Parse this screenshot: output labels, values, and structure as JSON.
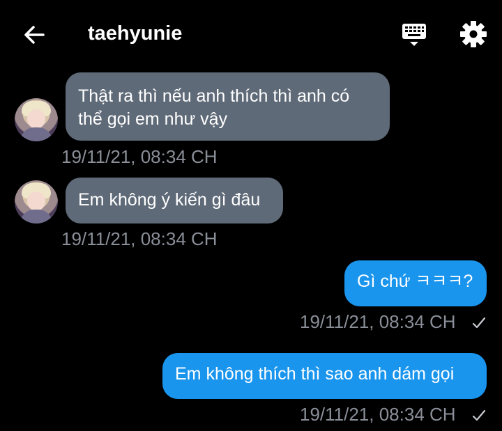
{
  "header": {
    "title": "taehyunie",
    "back_icon": "arrow-left-icon",
    "keyboard_icon": "keyboard-icon",
    "settings_icon": "gear-icon"
  },
  "colors": {
    "background": "#000000",
    "incoming_bubble": "#5f6a78",
    "outgoing_bubble": "#1a95ee",
    "timestamp": "#8a8f98"
  },
  "messages": [
    {
      "direction": "incoming",
      "text_lines": [
        "Thật ra thì nếu anh thích thì anh có",
        "thể gọi em như vậy"
      ],
      "time": "19/11/21, 08:34 CH"
    },
    {
      "direction": "incoming",
      "text": "Em không ý kiến gì đâu",
      "time": "19/11/21, 08:34 CH"
    },
    {
      "direction": "outgoing",
      "text": "Gì chứ ㅋㅋㅋ?",
      "time": "19/11/21, 08:34 CH",
      "status_icon": "check-icon"
    },
    {
      "direction": "outgoing",
      "text": "Em không thích thì sao anh dám gọi",
      "time": "19/11/21, 08:34 CH",
      "status_icon": "check-icon"
    }
  ]
}
